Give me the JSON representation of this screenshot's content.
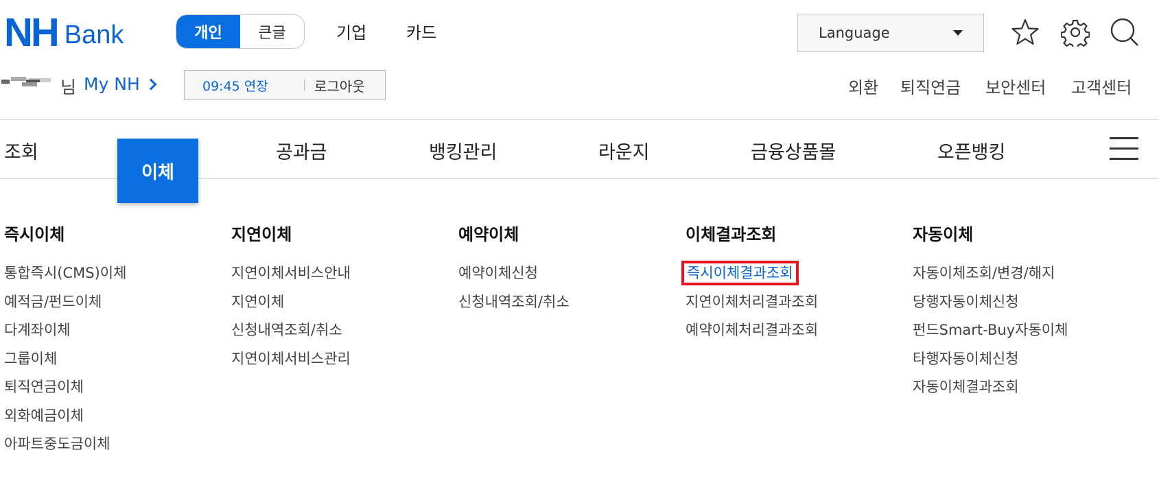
{
  "header": {
    "logo": {
      "nh": "NH",
      "bank": "Bank"
    },
    "segments": [
      {
        "label": "개인",
        "active": true
      },
      {
        "label": "큰글",
        "active": false
      }
    ],
    "top_links": [
      "기업",
      "카드"
    ],
    "language": {
      "label": "Language"
    },
    "icons": [
      "star-icon",
      "gear-icon",
      "search-icon"
    ]
  },
  "user": {
    "suffix": "님",
    "my_nh": "My NH",
    "session_timer": "09:45 연장",
    "logout": "로그아웃"
  },
  "util_links": [
    "외환",
    "퇴직연금",
    "보안센터",
    "고객센터"
  ],
  "gnb": {
    "items": [
      "조회",
      "이체",
      "공과금",
      "뱅킹관리",
      "라운지",
      "금융상품몰",
      "오픈뱅킹"
    ],
    "active": "이체",
    "menu_icon": "hamburger-icon"
  },
  "mega_menu": [
    {
      "title": "즉시이체",
      "items": [
        "통합즉시(CMS)이체",
        "예적금/펀드이체",
        "다계좌이체",
        "그룹이체",
        "퇴직연금이체",
        "외화예금이체",
        "아파트중도금이체"
      ]
    },
    {
      "title": "지연이체",
      "items": [
        "지연이체서비스안내",
        "지연이체",
        "신청내역조회/취소",
        "지연이체서비스관리"
      ]
    },
    {
      "title": "예약이체",
      "items": [
        "예약이체신청",
        "신청내역조회/취소"
      ]
    },
    {
      "title": "이체결과조회",
      "items": [
        "즉시이체결과조회",
        "지연이체처리결과조회",
        "예약이체처리결과조회"
      ],
      "highlighted_item": "즉시이체결과조회"
    },
    {
      "title": "자동이체",
      "items": [
        "자동이체조회/변경/해지",
        "당행자동이체신청",
        "펀드Smart-Buy자동이체",
        "타행자동이체신청",
        "자동이체결과조회"
      ]
    }
  ],
  "colors": {
    "brand_blue": "#0a64d6",
    "active_tab": "#0a6fe0",
    "highlight_box": "#e8141f"
  }
}
